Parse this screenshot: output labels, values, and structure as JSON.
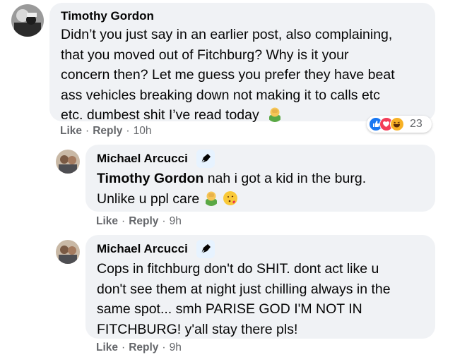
{
  "comments": [
    {
      "author": "Timothy Gordon",
      "text_lines": [
        "Didn’t you just say in an earlier post, also complaining,",
        "that you moved out of Fitchburg? Why is it your",
        "concern then? Let me guess you prefer they have beat",
        "ass vehicles breaking down not making it to calls etc",
        "etc. dumbest shit I’ve read today"
      ],
      "like_label": "Like",
      "reply_label": "Reply",
      "sep": "·",
      "time": "10h",
      "reaction_count": "23"
    },
    {
      "author": "Michael Arcucci",
      "mention": "Timothy Gordon",
      "line1_rest": " nah i got a kid in the burg.",
      "line2": "Unlike u ppl care ",
      "like_label": "Like",
      "reply_label": "Reply",
      "sep": "·",
      "time": "9h"
    },
    {
      "author": "Michael Arcucci",
      "text_lines": [
        "Cops in fitchburg don't do SHIT. dont act like u",
        "don't see them at night just chilling always in the",
        "same spot... smh PARISE GOD I'M NOT IN",
        "FITCHBURG! y'all stay there pls!"
      ],
      "like_label": "Like",
      "reply_label": "Reply",
      "sep": "·",
      "time": "9h"
    }
  ],
  "icons": {
    "author_badge": "pen-icon",
    "reaction_like": "like-reaction-icon",
    "reaction_love": "love-reaction-icon",
    "reaction_haha": "haha-reaction-icon",
    "emoji_facepalm": "man-facepalming-emoji",
    "emoji_kiss": "face-blowing-kiss-emoji"
  },
  "colors": {
    "bubble": "#f0f2f5",
    "meta_text": "#65676b",
    "like_blue": "#1877f2",
    "love_red": "#f33e58",
    "haha_yellow": "#f7b125"
  }
}
